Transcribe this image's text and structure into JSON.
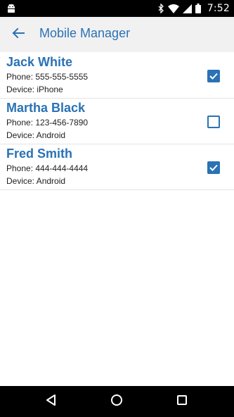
{
  "status_bar": {
    "time": "7:52",
    "icons": [
      "android-icon",
      "bluetooth-icon",
      "wifi-icon",
      "signal-icon",
      "battery-icon"
    ]
  },
  "app_bar": {
    "back_icon": "arrow-back-icon",
    "title": "Mobile Manager"
  },
  "contacts": [
    {
      "name": "Jack White",
      "phone": "Phone: 555-555-5555",
      "device": "Device: iPhone",
      "checked": true
    },
    {
      "name": "Martha Black",
      "phone": "Phone: 123-456-7890",
      "device": "Device: Android",
      "checked": false
    },
    {
      "name": "Fred Smith",
      "phone": "Phone: 444-444-4444",
      "device": "Device: Android",
      "checked": true
    }
  ],
  "nav_bar": {
    "icons": [
      "back-triangle-icon",
      "home-circle-icon",
      "recents-square-icon"
    ]
  },
  "colors": {
    "accent": "#2a72b5",
    "app_bar_bg": "#f1f1f1",
    "system_bar_bg": "#000000"
  }
}
